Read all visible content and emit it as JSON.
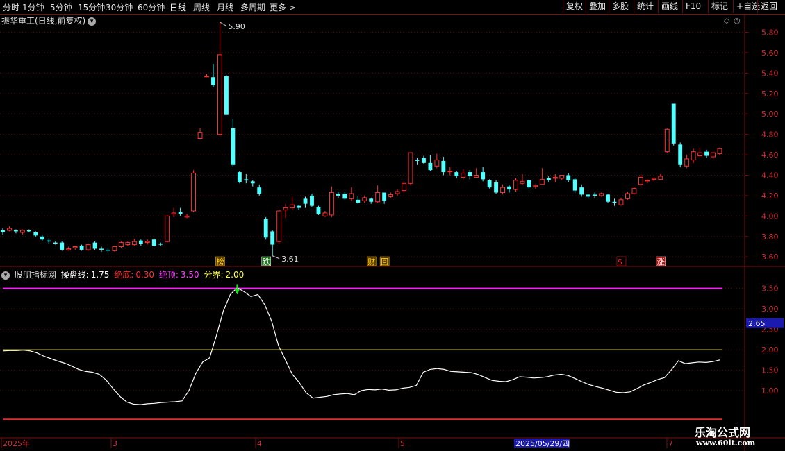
{
  "toolbar": {
    "periods": [
      "分时",
      "1分钟",
      "5分钟",
      "15分钟",
      "30分钟",
      "60分钟",
      "日线",
      "周线",
      "月线",
      "多周期",
      "更多 >"
    ],
    "active_period": "日线",
    "buttons": [
      "复权",
      "叠加",
      "多股",
      "统计",
      "画线",
      "F10",
      "标记",
      "+自选",
      "返回"
    ]
  },
  "main_chart": {
    "title": "振华重工(日线,前复权)",
    "y_ticks": [
      "5.80",
      "5.60",
      "5.40",
      "5.20",
      "5.00",
      "4.80",
      "4.60",
      "4.40",
      "4.20",
      "4.00",
      "3.80",
      "3.60"
    ],
    "high_label": "5.90",
    "low_label": "3.61",
    "markers": [
      {
        "text": "榜",
        "color": "#ffd200",
        "bg": "#5a3a00"
      },
      {
        "text": "跌",
        "color": "#ffffff",
        "bg": "#1f7a1f"
      },
      {
        "text": "财",
        "color": "#ffd200",
        "bg": "#5a3a00"
      },
      {
        "text": "回",
        "color": "#ffd200",
        "bg": "#5a3a00"
      },
      {
        "text": "$",
        "color": "#ff2020",
        "bg": "#000000"
      },
      {
        "text": "涨",
        "color": "#ffffff",
        "bg": "#b01010"
      }
    ]
  },
  "indicator": {
    "name": "股朋指标网",
    "series_label": "操盘线:",
    "series_value": "1.75",
    "bottom_label": "绝底:",
    "bottom_value": "0.30",
    "top_label": "绝顶:",
    "top_value": "3.50",
    "boundary_label": "分界:",
    "boundary_value": "2.00",
    "y_ticks": [
      "3.50",
      "3.00",
      "2.50",
      "2.00",
      "1.50",
      "1.00"
    ],
    "cursor_value": "2.65",
    "colors": {
      "series": "#ffffff",
      "bottom": "#ff2020",
      "top": "#ff20ff",
      "boundary": "#ffff40"
    }
  },
  "x_axis": {
    "labels": [
      "2025年",
      "3",
      "4",
      "5",
      "7"
    ],
    "cursor_date": "2025/05/29/四"
  },
  "watermark": {
    "name": "乐淘公式网",
    "url": "www.60lt.com"
  },
  "chart_data": [
    {
      "type": "candlestick",
      "title": "振华重工(日线,前复权)",
      "ylim": [
        3.52,
        5.98
      ],
      "up_color": "#ff3232",
      "down_color": "#54ffff",
      "candles": [
        [
          3.86,
          3.84,
          3.88,
          3.82
        ],
        [
          3.86,
          3.88,
          3.9,
          3.85
        ],
        [
          3.86,
          3.85,
          3.87,
          3.83
        ],
        [
          3.84,
          3.86,
          3.87,
          3.82
        ],
        [
          3.86,
          3.85,
          3.87,
          3.84
        ],
        [
          3.84,
          3.81,
          3.85,
          3.8
        ],
        [
          3.8,
          3.77,
          3.81,
          3.76
        ],
        [
          3.76,
          3.75,
          3.78,
          3.73
        ],
        [
          3.74,
          3.73,
          3.75,
          3.72
        ],
        [
          3.74,
          3.67,
          3.75,
          3.66
        ],
        [
          3.67,
          3.68,
          3.7,
          3.66
        ],
        [
          3.69,
          3.7,
          3.71,
          3.67
        ],
        [
          3.71,
          3.67,
          3.72,
          3.66
        ],
        [
          3.67,
          3.72,
          3.73,
          3.66
        ],
        [
          3.74,
          3.68,
          3.75,
          3.67
        ],
        [
          3.68,
          3.67,
          3.7,
          3.65
        ],
        [
          3.67,
          3.66,
          3.69,
          3.64
        ],
        [
          3.66,
          3.7,
          3.71,
          3.65
        ],
        [
          3.7,
          3.74,
          3.75,
          3.69
        ],
        [
          3.72,
          3.74,
          3.75,
          3.71
        ],
        [
          3.72,
          3.75,
          3.78,
          3.71
        ],
        [
          3.76,
          3.73,
          3.77,
          3.71
        ],
        [
          3.74,
          3.75,
          3.77,
          3.72
        ],
        [
          3.77,
          3.71,
          3.78,
          3.7
        ],
        [
          3.73,
          3.72,
          3.74,
          3.71
        ],
        [
          3.75,
          4.0,
          4.01,
          3.74
        ],
        [
          4.02,
          4.03,
          4.08,
          3.99
        ],
        [
          4.04,
          4.02,
          4.08,
          4.0
        ],
        [
          3.99,
          4.0,
          4.02,
          3.98
        ],
        [
          4.05,
          4.42,
          4.45,
          4.04
        ],
        [
          4.76,
          4.82,
          4.86,
          4.75
        ],
        [
          5.37,
          5.37,
          5.39,
          5.36
        ],
        [
          5.36,
          5.28,
          5.49,
          5.26
        ],
        [
          4.8,
          5.58,
          5.9,
          4.78
        ],
        [
          5.37,
          4.99,
          5.38,
          4.99
        ],
        [
          4.86,
          4.5,
          4.95,
          4.48
        ],
        [
          4.43,
          4.33,
          4.44,
          4.32
        ],
        [
          4.36,
          4.35,
          4.41,
          4.32
        ],
        [
          4.34,
          4.32,
          4.35,
          4.29
        ],
        [
          4.28,
          4.22,
          4.31,
          4.2
        ],
        [
          3.97,
          3.79,
          3.99,
          3.77
        ],
        [
          3.85,
          3.72,
          3.86,
          3.61
        ],
        [
          3.75,
          4.05,
          4.06,
          3.73
        ],
        [
          4.06,
          4.08,
          4.12,
          3.98
        ],
        [
          4.08,
          4.11,
          4.19,
          4.06
        ],
        [
          4.1,
          4.08,
          4.11,
          4.06
        ],
        [
          4.17,
          4.12,
          4.19,
          4.08
        ],
        [
          4.2,
          4.1,
          4.22,
          4.09
        ],
        [
          4.09,
          4.02,
          4.1,
          4.01
        ],
        [
          4.0,
          4.03,
          4.05,
          3.99
        ],
        [
          4.01,
          4.23,
          4.29,
          3.99
        ],
        [
          4.22,
          4.2,
          4.24,
          4.18
        ],
        [
          4.22,
          4.17,
          4.24,
          4.16
        ],
        [
          4.17,
          4.22,
          4.28,
          4.15
        ],
        [
          4.16,
          4.13,
          4.2,
          4.12
        ],
        [
          4.15,
          4.18,
          4.2,
          4.13
        ],
        [
          4.17,
          4.14,
          4.18,
          4.12
        ],
        [
          4.14,
          4.23,
          4.3,
          4.13
        ],
        [
          4.23,
          4.15,
          4.23,
          4.12
        ],
        [
          4.19,
          4.21,
          4.23,
          4.18
        ],
        [
          4.22,
          4.24,
          4.26,
          4.2
        ],
        [
          4.25,
          4.32,
          4.34,
          4.23
        ],
        [
          4.32,
          4.62,
          4.62,
          4.3
        ],
        [
          4.55,
          4.54,
          4.57,
          4.5
        ],
        [
          4.57,
          4.52,
          4.59,
          4.51
        ],
        [
          4.52,
          4.45,
          4.6,
          4.44
        ],
        [
          4.49,
          4.55,
          4.61,
          4.47
        ],
        [
          4.54,
          4.43,
          4.58,
          4.4
        ],
        [
          4.44,
          4.44,
          4.48,
          4.4
        ],
        [
          4.43,
          4.39,
          4.44,
          4.37
        ],
        [
          4.38,
          4.42,
          4.46,
          4.36
        ],
        [
          4.43,
          4.39,
          4.45,
          4.36
        ],
        [
          4.38,
          4.4,
          4.47,
          4.38
        ],
        [
          4.43,
          4.36,
          4.48,
          4.34
        ],
        [
          4.35,
          4.28,
          4.36,
          4.27
        ],
        [
          4.33,
          4.23,
          4.35,
          4.22
        ],
        [
          4.23,
          4.28,
          4.31,
          4.21
        ],
        [
          4.29,
          4.26,
          4.3,
          4.23
        ],
        [
          4.26,
          4.35,
          4.37,
          4.24
        ],
        [
          4.32,
          4.34,
          4.41,
          4.31
        ],
        [
          4.35,
          4.28,
          4.36,
          4.26
        ],
        [
          4.29,
          4.3,
          4.31,
          4.27
        ],
        [
          4.31,
          4.36,
          4.47,
          4.31
        ],
        [
          4.37,
          4.35,
          4.39,
          4.33
        ],
        [
          4.37,
          4.38,
          4.41,
          4.33
        ],
        [
          4.37,
          4.4,
          4.4,
          4.35
        ],
        [
          4.4,
          4.35,
          4.42,
          4.33
        ],
        [
          4.36,
          4.25,
          4.37,
          4.23
        ],
        [
          4.28,
          4.21,
          4.31,
          4.19
        ],
        [
          4.21,
          4.19,
          4.22,
          4.17
        ],
        [
          4.21,
          4.2,
          4.23,
          4.18
        ],
        [
          4.2,
          4.22,
          4.23,
          4.19
        ],
        [
          4.21,
          4.14,
          4.22,
          4.13
        ],
        [
          4.14,
          4.13,
          4.17,
          4.1
        ],
        [
          4.11,
          4.16,
          4.18,
          4.1
        ],
        [
          4.17,
          4.22,
          4.24,
          4.16
        ],
        [
          4.22,
          4.27,
          4.28,
          4.21
        ],
        [
          4.31,
          4.38,
          4.41,
          4.29
        ],
        [
          4.35,
          4.35,
          4.36,
          4.32
        ],
        [
          4.36,
          4.37,
          4.38,
          4.34
        ],
        [
          4.36,
          4.39,
          4.41,
          4.36
        ],
        [
          4.63,
          4.85,
          4.86,
          4.62
        ],
        [
          5.1,
          4.71,
          5.1,
          4.69
        ],
        [
          4.7,
          4.5,
          4.72,
          4.48
        ],
        [
          4.49,
          4.56,
          4.6,
          4.47
        ],
        [
          4.55,
          4.63,
          4.66,
          4.52
        ],
        [
          4.59,
          4.62,
          4.67,
          4.58
        ],
        [
          4.63,
          4.59,
          4.65,
          4.57
        ],
        [
          4.58,
          4.62,
          4.63,
          4.56
        ],
        [
          4.61,
          4.66,
          4.67,
          4.6
        ]
      ]
    },
    {
      "type": "line",
      "name": "操盘线",
      "ylim": [
        0.0,
        3.85
      ],
      "hlines": [
        {
          "value": 3.5,
          "color": "#ff20ff"
        },
        {
          "value": 2.0,
          "color": "#ffff40"
        },
        {
          "value": 0.3,
          "color": "#ff2020"
        }
      ],
      "values": [
        1.97,
        1.98,
        1.98,
        1.99,
        1.97,
        1.92,
        1.84,
        1.78,
        1.72,
        1.67,
        1.6,
        1.52,
        1.47,
        1.45,
        1.4,
        1.26,
        1.05,
        0.86,
        0.72,
        0.67,
        0.66,
        0.68,
        0.69,
        0.71,
        0.72,
        0.73,
        0.75,
        1.0,
        1.42,
        1.7,
        1.8,
        2.35,
        2.95,
        3.35,
        3.52,
        3.42,
        3.3,
        3.35,
        3.1,
        2.7,
        2.1,
        1.75,
        1.4,
        1.2,
        0.95,
        0.82,
        0.84,
        0.86,
        0.9,
        0.92,
        0.93,
        0.9,
        1.0,
        1.03,
        1.02,
        1.04,
        1.01,
        1.02,
        1.06,
        1.08,
        1.13,
        1.45,
        1.52,
        1.54,
        1.52,
        1.47,
        1.46,
        1.45,
        1.44,
        1.39,
        1.32,
        1.25,
        1.23,
        1.22,
        1.27,
        1.34,
        1.33,
        1.31,
        1.32,
        1.34,
        1.38,
        1.4,
        1.37,
        1.3,
        1.22,
        1.15,
        1.1,
        1.06,
        1.01,
        0.96,
        0.95,
        0.97,
        1.05,
        1.14,
        1.2,
        1.27,
        1.32,
        1.51,
        1.73,
        1.66,
        1.68,
        1.7,
        1.69,
        1.71,
        1.75
      ]
    }
  ]
}
